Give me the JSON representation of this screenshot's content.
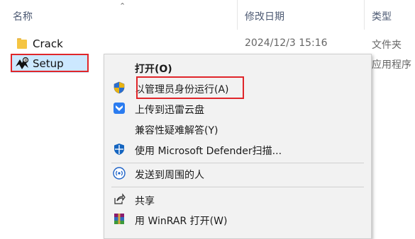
{
  "columns": {
    "name": "名称",
    "modified": "修改日期",
    "type": "类型"
  },
  "files": [
    {
      "name": "Crack",
      "date": "2024/12/3 15:16",
      "type": "文件夹",
      "icon": "folder-icon"
    },
    {
      "name": "Setup",
      "date": "",
      "type": "应用程序",
      "icon": "setup-app-icon"
    }
  ],
  "context_menu": {
    "items": [
      {
        "label": "打开(O)",
        "icon": ""
      },
      {
        "label": "以管理员身份运行(A)",
        "icon": "uac-shield-icon"
      },
      {
        "label": "上传到迅雷云盘",
        "icon": "thunder-cloud-icon"
      },
      {
        "label": "兼容性疑难解答(Y)",
        "icon": ""
      },
      {
        "label": "使用 Microsoft Defender扫描...",
        "icon": "defender-shield-icon"
      },
      {
        "label": "发送到周围的人",
        "icon": "nearby-share-icon"
      },
      {
        "label": "共享",
        "icon": "share-icon"
      },
      {
        "label": "用 WinRAR 打开(W)",
        "icon": "winrar-icon"
      }
    ]
  },
  "colors": {
    "selection": "#cce8ff",
    "highlight_box": "#e0262a",
    "menu_bg": "#f2f2f2"
  }
}
